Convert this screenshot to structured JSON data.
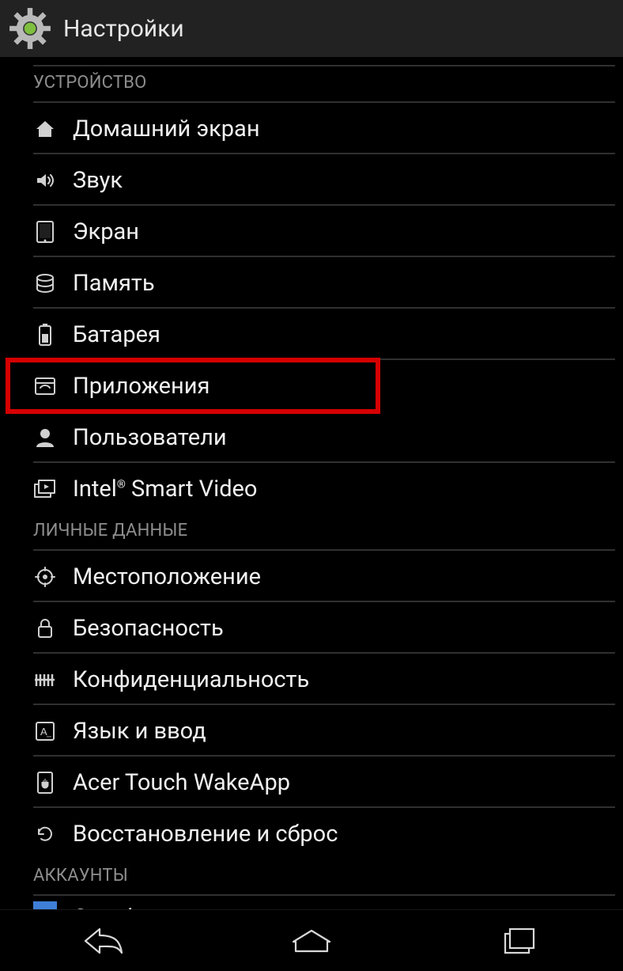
{
  "title": "Настройки",
  "sections": [
    {
      "type": "partial"
    },
    {
      "type": "header",
      "label": "УСТРОЙСТВО"
    },
    {
      "type": "item",
      "icon": "home",
      "name": "home-screen",
      "label": "Домашний экран"
    },
    {
      "type": "item",
      "icon": "sound",
      "name": "sound",
      "label": "Звук"
    },
    {
      "type": "item",
      "icon": "display",
      "name": "display",
      "label": "Экран"
    },
    {
      "type": "item",
      "icon": "storage",
      "name": "storage",
      "label": "Память"
    },
    {
      "type": "item",
      "icon": "battery",
      "name": "battery",
      "label": "Батарея"
    },
    {
      "type": "item",
      "icon": "apps",
      "name": "apps",
      "label": "Приложения",
      "highlighted": true
    },
    {
      "type": "item",
      "icon": "users",
      "name": "users",
      "label": "Пользователи"
    },
    {
      "type": "item",
      "icon": "video",
      "name": "intel-smart-video",
      "label_html": "Intel<span class='reg'>®</span> Smart Video",
      "no_divider": true,
      "klass": "smart-video"
    },
    {
      "type": "header",
      "label": "ЛИЧНЫЕ ДАННЫЕ"
    },
    {
      "type": "item",
      "icon": "location",
      "name": "location",
      "label": "Местоположение"
    },
    {
      "type": "item",
      "icon": "security",
      "name": "security",
      "label": "Безопасность"
    },
    {
      "type": "item",
      "icon": "privacy",
      "name": "privacy",
      "label": "Конфиденциальность"
    },
    {
      "type": "item",
      "icon": "language",
      "name": "language-input",
      "label": "Язык и ввод"
    },
    {
      "type": "item",
      "icon": "touch",
      "name": "acer-touch-wakeapp",
      "label": "Acer Touch WakeApp"
    },
    {
      "type": "item",
      "icon": "reset",
      "name": "backup-reset",
      "label": "Восстановление и сброс",
      "no_divider": true
    },
    {
      "type": "header",
      "label": "АККАУНТЫ"
    },
    {
      "type": "item",
      "icon": "google",
      "name": "google-account",
      "label": "Google",
      "klass": "google-row",
      "no_divider": true
    }
  ]
}
